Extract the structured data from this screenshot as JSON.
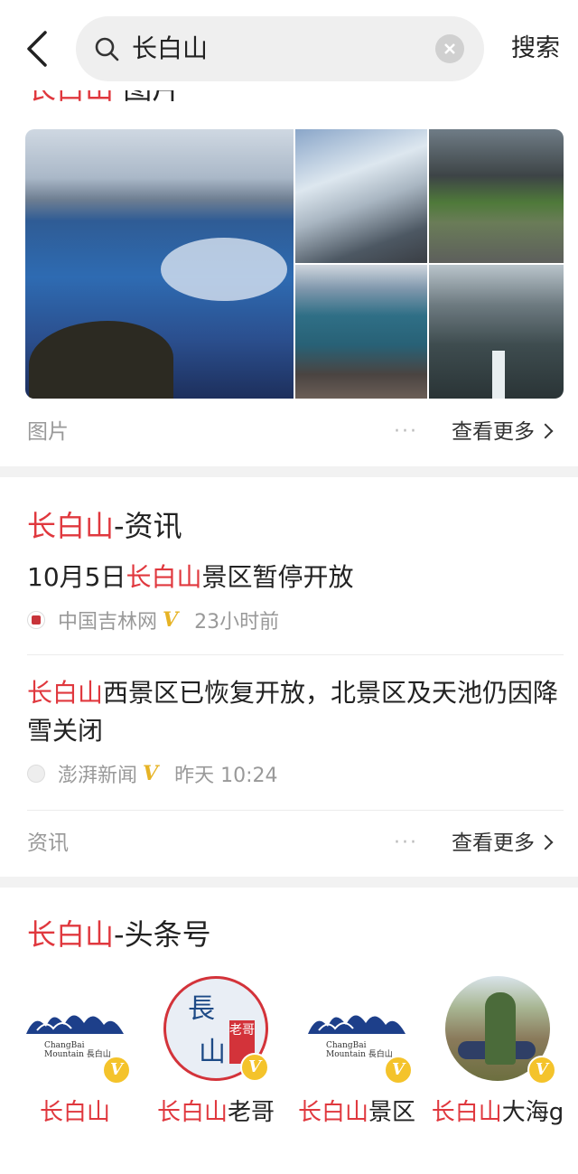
{
  "search": {
    "query": "长白山",
    "button_label": "搜索"
  },
  "images_section": {
    "header_keyword": "长白山",
    "header_suffix": "图片",
    "footer_label": "图片",
    "more_dots": "···",
    "more_label": "查看更多"
  },
  "news_section": {
    "title_keyword": "长白山",
    "title_suffix": "-资讯",
    "items": [
      {
        "title_prefix": "10月5日",
        "title_keyword": "长白山",
        "title_suffix": "景区暂停开放",
        "source": "中国吉林网",
        "verified": "V",
        "time": "23小时前"
      },
      {
        "title_prefix": "",
        "title_keyword": "长白山",
        "title_suffix": "西景区已恢复开放，北景区及天池仍因降雪关闭",
        "source": "澎湃新闻",
        "verified": "V",
        "time": "昨天 10:24"
      }
    ],
    "footer_label": "资讯",
    "more_dots": "···",
    "more_label": "查看更多"
  },
  "toutiao_section": {
    "title_keyword": "长白山",
    "title_suffix": "-头条号",
    "accounts": [
      {
        "keyword": "长白山",
        "suffix": "",
        "verified": "V",
        "logo_caption_1": "ChangBai",
        "logo_caption_2": "Mountain 長白山"
      },
      {
        "keyword": "长白山",
        "suffix": "老哥",
        "verified": "V",
        "logo_chars": "長 白 山",
        "logo_tag": "老哥"
      },
      {
        "keyword": "长白山",
        "suffix": "景区",
        "verified": "V",
        "logo_caption_1": "ChangBai",
        "logo_caption_2": "Mountain 長白山"
      },
      {
        "keyword": "长白山",
        "suffix": "大海g",
        "verified": "V"
      }
    ]
  },
  "colors": {
    "accent_red": "#e0383e",
    "verified_gold": "#e6b325"
  }
}
